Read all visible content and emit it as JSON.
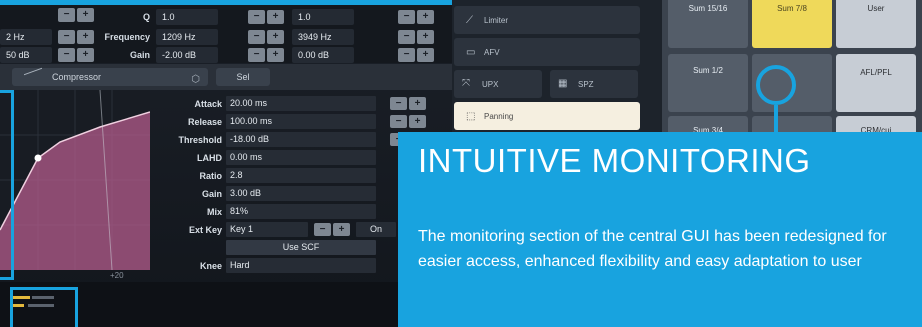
{
  "colors": {
    "accent": "#18a3df",
    "highlight": "#efd95a",
    "panning": "#f5efe0"
  },
  "eq": {
    "col1": [
      {
        "value": "2 Hz"
      },
      {
        "value": "50 dB"
      }
    ],
    "col2": [
      {
        "label": "Q",
        "value": "1.0"
      },
      {
        "label": "Frequency",
        "value": "1209 Hz"
      },
      {
        "label": "Gain",
        "value": "-2.00 dB"
      }
    ],
    "col3": [
      {
        "value": "1.0"
      },
      {
        "value": "3949 Hz"
      },
      {
        "value": "0.00 dB"
      }
    ]
  },
  "compressor": {
    "dropdown_label": "Compressor",
    "sel_label": "Sel",
    "params": [
      {
        "label": "Attack",
        "value": "20.00 ms"
      },
      {
        "label": "Release",
        "value": "100.00 ms"
      },
      {
        "label": "Threshold",
        "value": "-18.00 dB"
      },
      {
        "label": "LAHD",
        "value": "0.00 ms"
      },
      {
        "label": "Ratio",
        "value": "2.8"
      },
      {
        "label": "Gain",
        "value": "3.00 dB"
      },
      {
        "label": "Mix",
        "value": "81%"
      },
      {
        "label": "Ext Key",
        "value": "Key 1",
        "toggle": "On"
      }
    ],
    "use_scf": "Use SCF",
    "knee_label": "Knee",
    "knee_value": "Hard",
    "axis_tick": "+20"
  },
  "monitor": {
    "limiter": "Limiter",
    "afv": "AFV",
    "upx": "UPX",
    "spz": "SPZ",
    "panning": "Panning"
  },
  "buses": {
    "sum_15_16": "Sum 15/16",
    "sum_7_8": "Sum 7/8",
    "user": "User",
    "sum_1_2": "Sum 1/2",
    "afl_pfl": "AFL/PFL",
    "sum_3_4": "Sum 3/4",
    "crm": "CRM/cui"
  },
  "info": {
    "title": "INTUITIVE MONITORING",
    "body": "The monitoring section of the central GUI has been redesigned for easier access, enhanced flexibility and easy adaptation to user"
  }
}
